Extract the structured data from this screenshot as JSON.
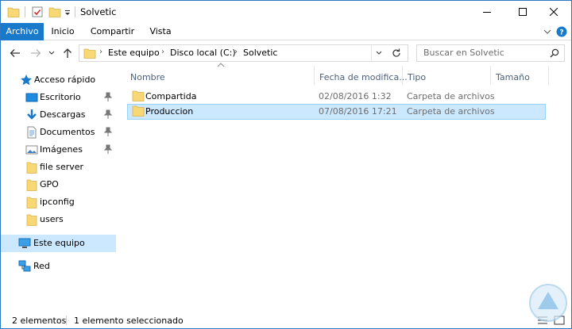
{
  "window": {
    "title": "Solvetic"
  },
  "ribbon": {
    "tabs": [
      {
        "label": "Archivo"
      },
      {
        "label": "Inicio"
      },
      {
        "label": "Compartir"
      },
      {
        "label": "Vista"
      }
    ]
  },
  "address": {
    "crumbs": [
      "Este equipo",
      "Disco local (C:)",
      "Solvetic"
    ]
  },
  "search": {
    "placeholder": "Buscar en Solvetic"
  },
  "nav": {
    "quick_access": "Acceso rápido",
    "items": [
      {
        "label": "Escritorio",
        "icon": "desktop-icon",
        "pinned": true
      },
      {
        "label": "Descargas",
        "icon": "download-icon",
        "pinned": true
      },
      {
        "label": "Documentos",
        "icon": "document-icon",
        "pinned": true
      },
      {
        "label": "Imágenes",
        "icon": "pictures-icon",
        "pinned": true
      },
      {
        "label": "file server",
        "icon": "folder-icon",
        "pinned": false
      },
      {
        "label": "GPO",
        "icon": "folder-icon",
        "pinned": false
      },
      {
        "label": "ipconfig",
        "icon": "folder-icon",
        "pinned": false
      },
      {
        "label": "users",
        "icon": "folder-icon",
        "pinned": false
      }
    ],
    "this_pc": "Este equipo",
    "network": "Red"
  },
  "columns": {
    "name": "Nombre",
    "date": "Fecha de modifica...",
    "type": "Tipo",
    "size": "Tamaño"
  },
  "files": [
    {
      "name": "Compartida",
      "date": "02/08/2016 1:32",
      "type": "Carpeta de archivos",
      "selected": false
    },
    {
      "name": "Produccion",
      "date": "07/08/2016 17:21",
      "type": "Carpeta de archivos",
      "selected": true
    }
  ],
  "status": {
    "count": "2 elementos",
    "selection": "1 elemento seleccionado"
  },
  "colors": {
    "accent": "#1979ca",
    "selection": "#cce8ff",
    "folder": "#f8d775"
  }
}
